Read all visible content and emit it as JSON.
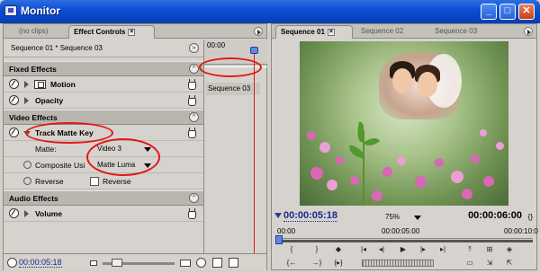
{
  "window": {
    "title": "Monitor",
    "buttons": {
      "minimize": "_",
      "maximize": "□",
      "close": "✕"
    }
  },
  "left": {
    "tabs": [
      {
        "label": "(no clips)"
      },
      {
        "label": "Effect Controls"
      }
    ],
    "sequence_path": "Sequence 01 * Sequence 03",
    "timeline_time": "00:00",
    "timeline_clip": "Sequence 03",
    "sections": {
      "fixed": "Fixed Effects",
      "video": "Video Effects",
      "audio": "Audio Effects"
    },
    "effects": {
      "motion": "Motion",
      "opacity": "Opacity",
      "track_matte": "Track Matte Key",
      "volume": "Volume"
    },
    "properties": {
      "matte_label": "Matte:",
      "matte_value": "Video 3",
      "composite_label": "Composite Usi",
      "composite_value": "Matte Luma",
      "reverse_label": "Reverse",
      "reverse_checkbox_label": "Reverse",
      "reverse_checked": false
    },
    "timecode": "00:00:05:18"
  },
  "right": {
    "tabs": [
      {
        "label": "Sequence 01"
      },
      {
        "label": "Sequence 02"
      },
      {
        "label": "Sequence 03"
      }
    ],
    "timecode_current": "00:00:05:18",
    "zoom": "75%",
    "timecode_duration": "00:00:06:00",
    "ruler": [
      "00:00",
      "00:00:05:00",
      "00:00:10:0"
    ]
  },
  "colors": {
    "annotation": "#e01818",
    "timecode": "#1b2a8a",
    "titlebar": "#0a4fd6"
  },
  "icons": [
    "monitor-app-icon",
    "fx-toggle-icon",
    "twisty-icon",
    "motion-icon",
    "hand-tool-icon",
    "keyframe-cycle-icon",
    "menu-arrow-icon",
    "scroll-right-icon"
  ]
}
